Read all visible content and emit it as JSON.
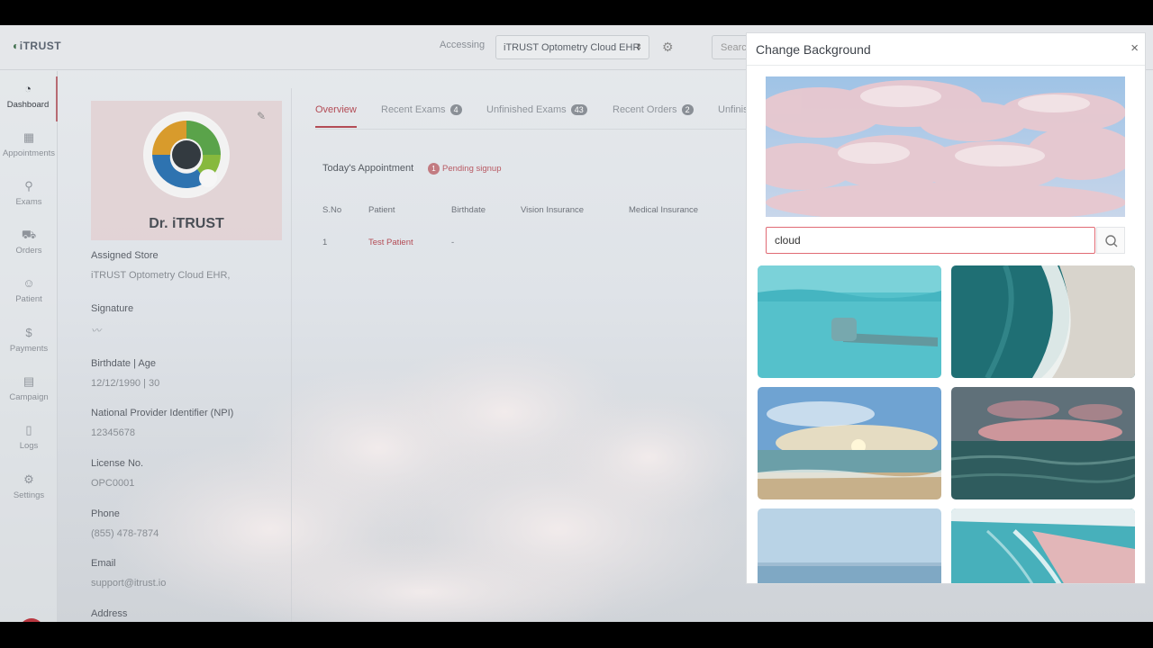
{
  "app": {
    "logo_text": "iTRUST"
  },
  "header": {
    "accessing_label": "Accessing",
    "store_select_value": "iTRUST Optometry Cloud EHR",
    "search_placeholder": "Search"
  },
  "sidebar": {
    "items": [
      {
        "label": "Dashboard",
        "icon": "gauge-icon",
        "active": true
      },
      {
        "label": "Appointments",
        "icon": "calendar-icon",
        "active": false
      },
      {
        "label": "Exams",
        "icon": "stethoscope-icon",
        "active": false
      },
      {
        "label": "Orders",
        "icon": "cart-icon",
        "active": false
      },
      {
        "label": "Patient",
        "icon": "patient-icon",
        "active": false
      },
      {
        "label": "Payments",
        "icon": "dollar-icon",
        "active": false
      },
      {
        "label": "Campaign",
        "icon": "campaign-icon",
        "active": false
      },
      {
        "label": "Logs",
        "icon": "file-icon",
        "active": false
      },
      {
        "label": "Settings",
        "icon": "gear-icon",
        "active": false
      }
    ]
  },
  "profile": {
    "name": "Dr. iTRUST",
    "fields": [
      {
        "label": "Assigned Store",
        "value": "iTRUST Optometry Cloud EHR,"
      },
      {
        "label": "Signature",
        "value": ""
      },
      {
        "label": "Birthdate | Age",
        "value": "12/12/1990 | 30"
      },
      {
        "label": "National Provider Identifier (NPI)",
        "value": "12345678"
      },
      {
        "label": "License No.",
        "value": "OPC0001"
      },
      {
        "label": "Phone",
        "value": "(855) 478-7874"
      },
      {
        "label": "Email",
        "value": "support@itrust.io"
      },
      {
        "label": "Address",
        "value": ""
      }
    ]
  },
  "tabs": [
    {
      "label": "Overview",
      "badge": "",
      "active": true
    },
    {
      "label": "Recent Exams",
      "badge": "4",
      "active": false
    },
    {
      "label": "Unfinished Exams",
      "badge": "43",
      "active": false
    },
    {
      "label": "Recent Orders",
      "badge": "2",
      "active": false
    },
    {
      "label": "Unfinis",
      "badge": "",
      "active": false
    }
  ],
  "appointments": {
    "title": "Today's Appointment",
    "pending_count": "1",
    "pending_label": "Pending signup",
    "columns": [
      "S.No",
      "Patient",
      "Birthdate",
      "Vision Insurance",
      "Medical Insurance"
    ],
    "rows": [
      {
        "sno": "1",
        "patient": "Test Patient",
        "birthdate": "-"
      }
    ]
  },
  "modal": {
    "title": "Change Background",
    "close_symbol": "×",
    "search_value": "cloud",
    "thumbnails": [
      "underwater-hand",
      "aerial-beach-waves",
      "sunset-beach",
      "ocean-dusk",
      "calm-sea-horizon",
      "aerial-shoreline"
    ]
  },
  "colors": {
    "accent": "#b34b55",
    "search_border": "#e06a74",
    "palette_button": "#b8363f"
  }
}
